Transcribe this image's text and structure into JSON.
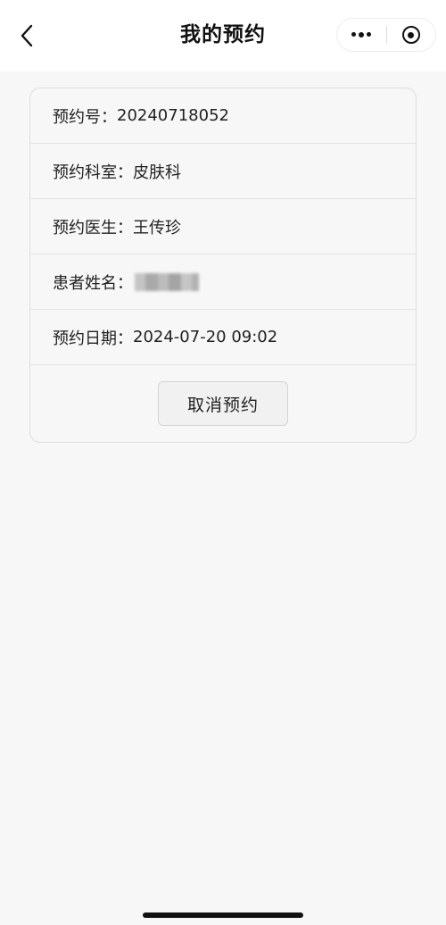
{
  "header": {
    "title": "我的预约",
    "back_icon": "chevron-left-icon",
    "more_icon": "more-dots-icon",
    "close_icon": "target-circle-icon"
  },
  "appointment": {
    "number_label": "预约号：",
    "number_value": "20240718052",
    "department_label": "预约科室：",
    "department_value": "皮肤科",
    "doctor_label": "预约医生：",
    "doctor_value": "王传珍",
    "patient_label": "患者姓名：",
    "patient_value_obscured": true,
    "date_label": "预约日期：",
    "date_value": "2024-07-20 09:02"
  },
  "actions": {
    "cancel_label": "取消预约"
  },
  "colors": {
    "background": "#f7f7f7",
    "navbar": "#ffffff",
    "card_border": "#dedede",
    "text": "#222222"
  }
}
